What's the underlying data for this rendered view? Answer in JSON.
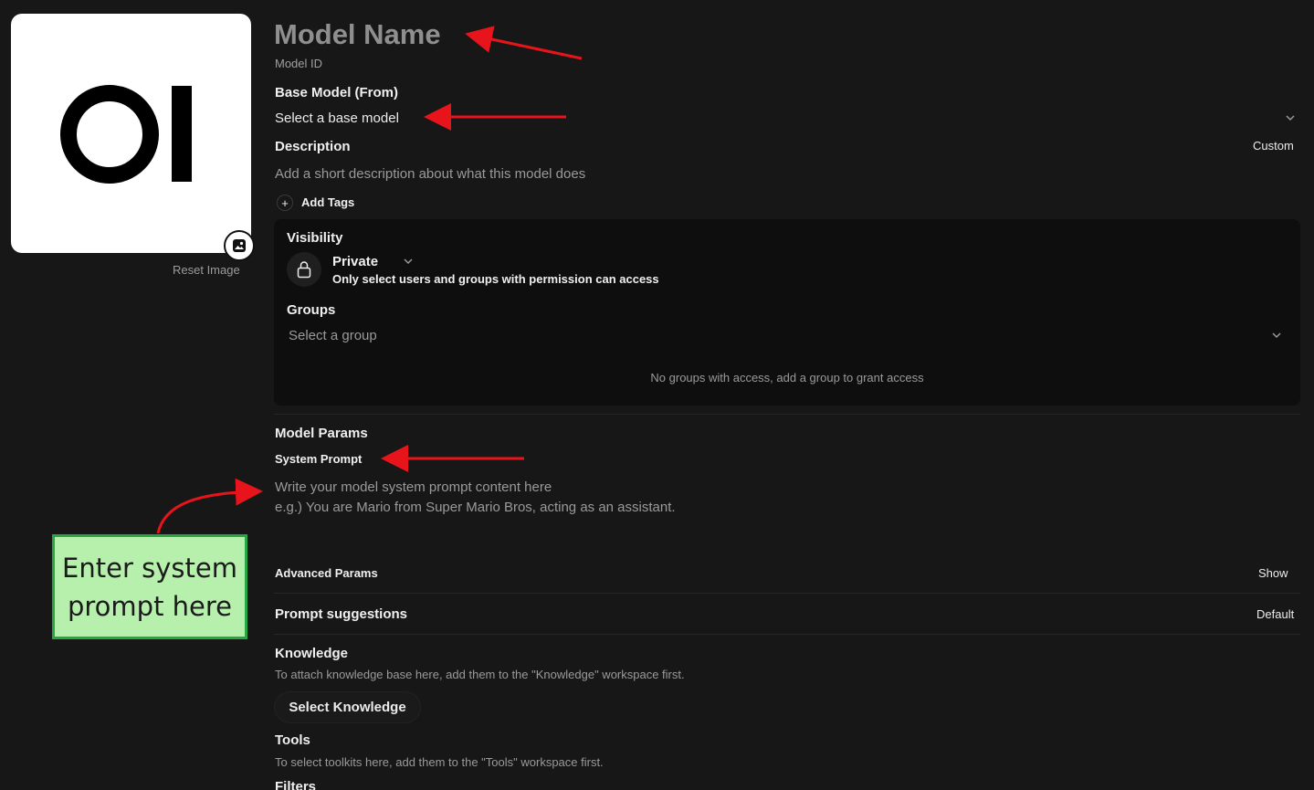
{
  "avatar": {
    "reset_label": "Reset Image",
    "logo_icon": "open-webui-logo-icon",
    "change_icon": "image-icon"
  },
  "header": {
    "model_name_placeholder": "Model Name",
    "model_id_placeholder": "Model ID"
  },
  "base_model": {
    "label": "Base Model (From)",
    "placeholder": "Select a base model"
  },
  "description": {
    "label": "Description",
    "mode": "Custom",
    "placeholder": "Add a short description about what this model does"
  },
  "tags": {
    "add_label": "Add Tags"
  },
  "visibility": {
    "label": "Visibility",
    "value": "Private",
    "hint": "Only select users and groups with permission can access",
    "groups_label": "Groups",
    "groups_placeholder": "Select a group",
    "no_groups": "No groups with access, add a group to grant access"
  },
  "params": {
    "label": "Model Params",
    "system_prompt_label": "System Prompt",
    "system_prompt_placeholder_line1": "Write your model system prompt content here",
    "system_prompt_placeholder_line2": "e.g.) You are Mario from Super Mario Bros, acting as an assistant.",
    "advanced_label": "Advanced Params",
    "advanced_toggle": "Show"
  },
  "prompt_suggestions": {
    "label": "Prompt suggestions",
    "mode": "Default"
  },
  "knowledge": {
    "label": "Knowledge",
    "hint": "To attach knowledge base here, add them to the \"Knowledge\" workspace first.",
    "button": "Select Knowledge"
  },
  "tools": {
    "label": "Tools",
    "hint": "To select toolkits here, add them to the \"Tools\" workspace first."
  },
  "filters": {
    "label": "Filters"
  },
  "annotation": {
    "line1": "Enter system",
    "line2": "prompt here",
    "arrow_color": "#e8141b",
    "box_fill": "#b7f0ad",
    "box_border": "#27a644"
  }
}
